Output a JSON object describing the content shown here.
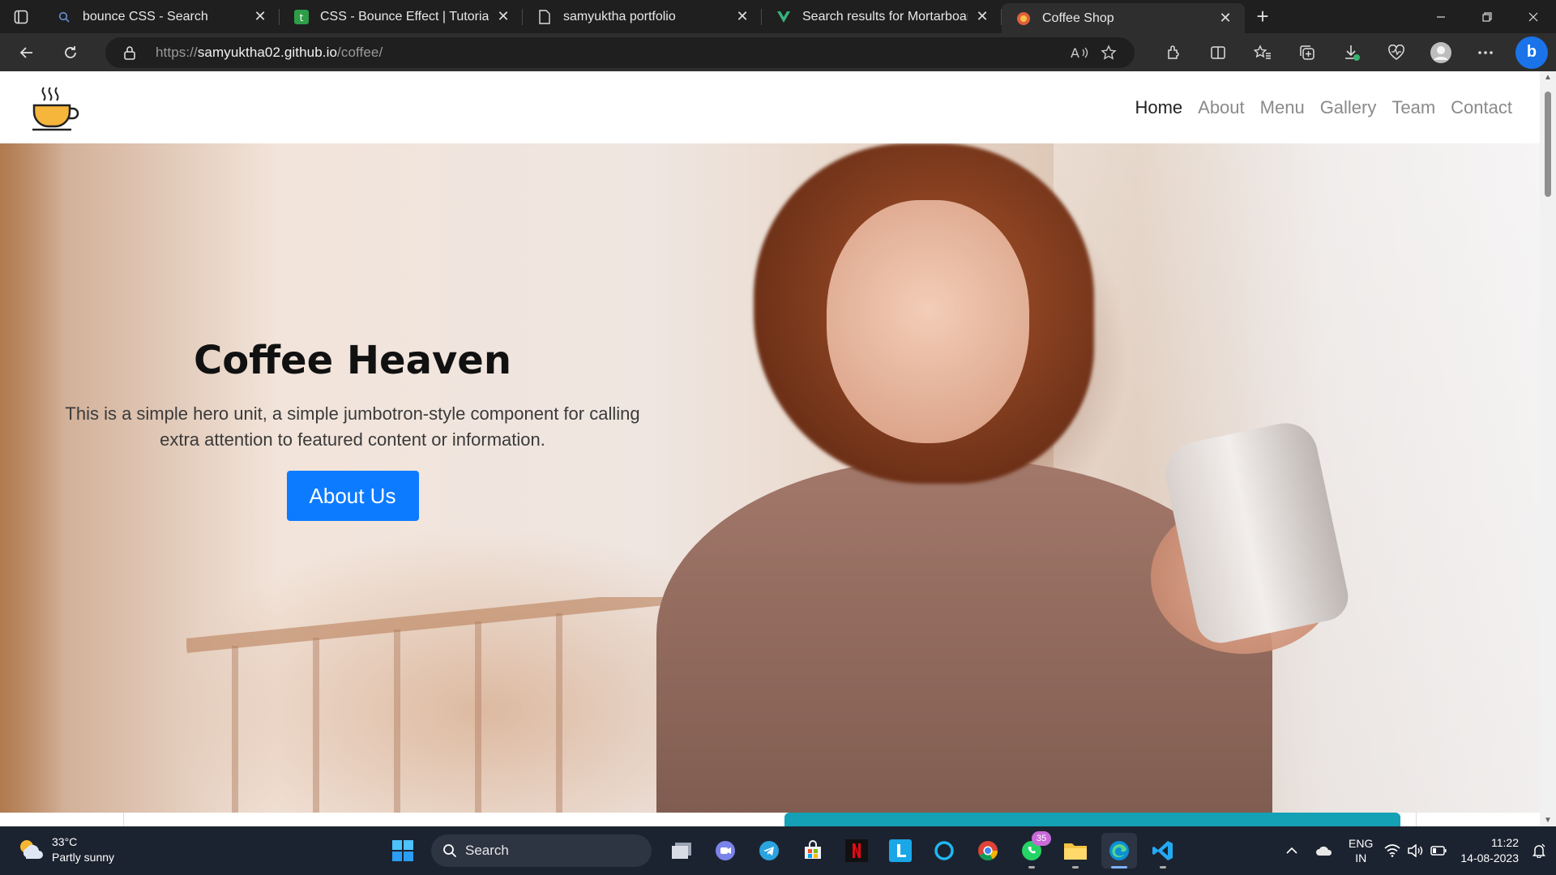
{
  "browser": {
    "tabs": [
      {
        "title": "bounce CSS - Search",
        "favicon": "search-icon"
      },
      {
        "title": "CSS - Bounce Effect | Tutorialspoint",
        "favicon": "tutorialspoint-icon"
      },
      {
        "title": "samyuktha portfolio",
        "favicon": "page-icon"
      },
      {
        "title": "Search results for Mortarboard -",
        "favicon": "vecteezy-icon"
      },
      {
        "title": "Coffee Shop",
        "favicon": "coffee-icon",
        "active": true
      }
    ],
    "address": {
      "scheme": "https://",
      "host": "samyuktha02.github.io",
      "path": "/coffee/"
    }
  },
  "page": {
    "nav": {
      "links": [
        "Home",
        "About",
        "Menu",
        "Gallery",
        "Team",
        "Contact"
      ],
      "active": "Home"
    },
    "hero": {
      "title": "Coffee Heaven",
      "text": "This is a simple hero unit, a simple jumbotron-style component for calling extra attention to featured content or information.",
      "button": "About Us"
    },
    "colors": {
      "button": "#0d7bff",
      "section_accent": "#14a0b5"
    }
  },
  "taskbar": {
    "weather": {
      "temp": "33°C",
      "desc": "Partly sunny"
    },
    "search_placeholder": "Search",
    "whatsapp_badge": "35",
    "lang": {
      "line1": "ENG",
      "line2": "IN"
    },
    "time": "11:22",
    "date": "14-08-2023"
  }
}
